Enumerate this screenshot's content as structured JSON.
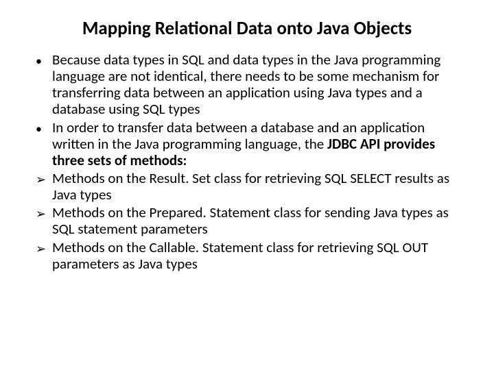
{
  "title": "Mapping Relational Data onto Java Objects",
  "bullets": [
    {
      "type": "dot",
      "text": "Because data types in SQL and data types in the Java programming language are not identical, there needs to be some mechanism for transferring data between an application using Java types and a database using SQL types"
    },
    {
      "type": "dot",
      "text": "In order to transfer data between a database and an application written in the Java programming language, the ",
      "boldTail": "JDBC API provides three sets of methods:"
    },
    {
      "type": "arrow",
      "text": "Methods on the Result. Set class for retrieving SQL SELECT results as Java types"
    },
    {
      "type": "arrow",
      "text": "Methods on the Prepared. Statement class for sending Java types as SQL statement parameters"
    },
    {
      "type": "arrow",
      "text": "Methods on the Callable. Statement class for retrieving SQL OUT parameters as Java types"
    }
  ]
}
